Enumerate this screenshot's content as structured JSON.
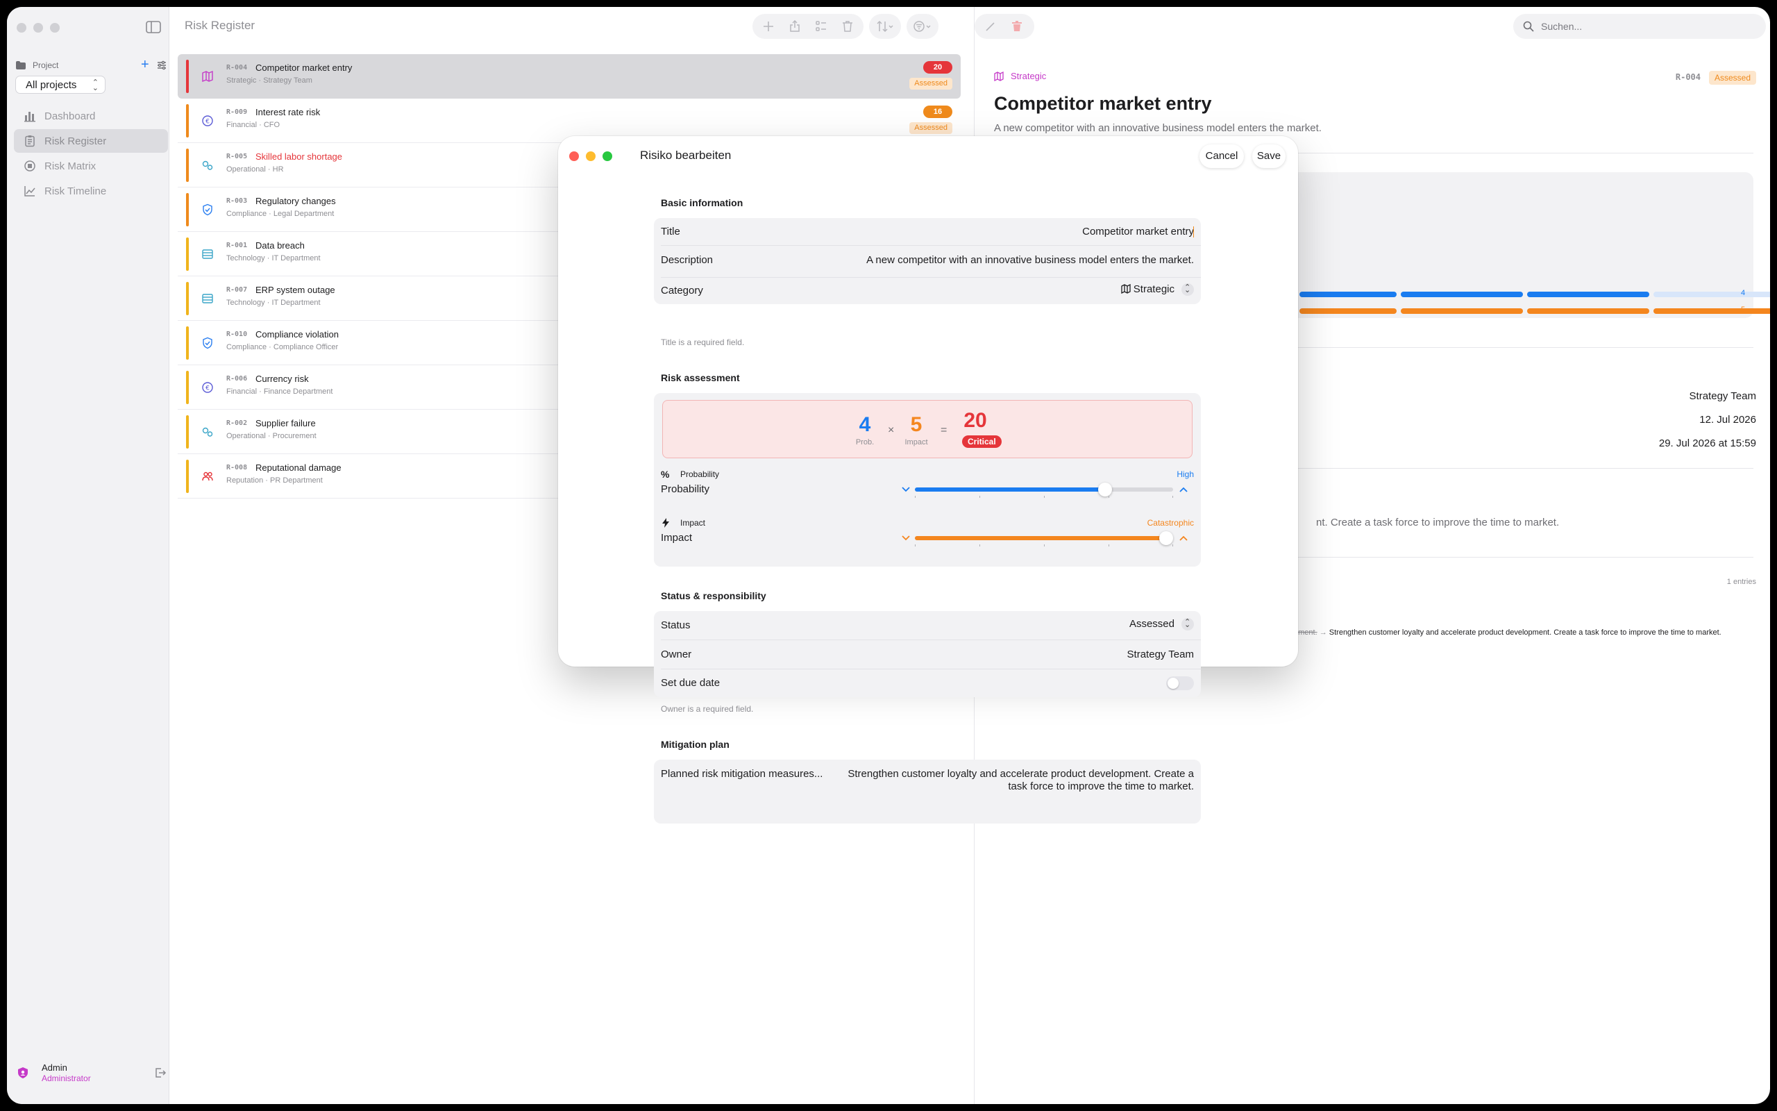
{
  "sidebar": {
    "project_label": "Project",
    "project_select": "All projects",
    "nav": [
      {
        "label": "Dashboard",
        "icon": "chart-bar-icon"
      },
      {
        "label": "Risk Register",
        "icon": "clipboard-icon"
      },
      {
        "label": "Risk Matrix",
        "icon": "grid-circle-icon"
      },
      {
        "label": "Risk Timeline",
        "icon": "line-chart-icon"
      }
    ],
    "user_name": "Admin",
    "user_role": "Administrator"
  },
  "list": {
    "title": "Risk Register",
    "items": [
      {
        "id": "R-004",
        "title": "Competitor market entry",
        "category": "Strategic",
        "owner": "Strategy Team",
        "score": "20",
        "status": "Assessed",
        "bar_color": "#e5353a",
        "score_color": "#e5353a",
        "icon": "map-icon",
        "icon_color": "#c53ac8",
        "title_color": "#1d1d1f"
      },
      {
        "id": "R-009",
        "title": "Interest rate risk",
        "category": "Financial",
        "owner": "CFO",
        "score": "16",
        "status": "Assessed",
        "bar_color": "#ef8a1c",
        "score_color": "#ef8a1c",
        "icon": "coin-icon",
        "icon_color": "#5b5bd6",
        "title_color": "#1d1d1f"
      },
      {
        "id": "R-005",
        "title": "Skilled labor shortage",
        "category": "Operational",
        "owner": "HR",
        "score": "",
        "status": "",
        "bar_color": "#ef8a1c",
        "score_color": "",
        "icon": "gears-icon",
        "icon_color": "#3aa5c8",
        "title_color": "#e5353a"
      },
      {
        "id": "R-003",
        "title": "Regulatory changes",
        "category": "Compliance",
        "owner": "Legal Department",
        "score": "",
        "status": "",
        "bar_color": "#ef8a1c",
        "score_color": "",
        "icon": "shield-check-icon",
        "icon_color": "#2a7ef0",
        "title_color": "#1d1d1f"
      },
      {
        "id": "R-001",
        "title": "Data breach",
        "category": "Technology",
        "owner": "IT Department",
        "score": "",
        "status": "",
        "bar_color": "#f0b41c",
        "score_color": "",
        "icon": "server-icon",
        "icon_color": "#3aa5c8",
        "title_color": "#1d1d1f"
      },
      {
        "id": "R-007",
        "title": "ERP system outage",
        "category": "Technology",
        "owner": "IT Department",
        "score": "",
        "status": "",
        "bar_color": "#f0b41c",
        "score_color": "",
        "icon": "server-icon",
        "icon_color": "#3aa5c8",
        "title_color": "#1d1d1f"
      },
      {
        "id": "R-010",
        "title": "Compliance violation",
        "category": "Compliance",
        "owner": "Compliance Officer",
        "score": "",
        "status": "",
        "bar_color": "#f0b41c",
        "score_color": "",
        "icon": "shield-check-icon",
        "icon_color": "#2a7ef0",
        "title_color": "#1d1d1f"
      },
      {
        "id": "R-006",
        "title": "Currency risk",
        "category": "Financial",
        "owner": "Finance Department",
        "score": "",
        "status": "",
        "bar_color": "#f0b41c",
        "score_color": "",
        "icon": "coin-icon",
        "icon_color": "#5b5bd6",
        "title_color": "#1d1d1f"
      },
      {
        "id": "R-002",
        "title": "Supplier failure",
        "category": "Operational",
        "owner": "Procurement",
        "score": "",
        "status": "",
        "bar_color": "#f0b41c",
        "score_color": "",
        "icon": "gears-icon",
        "icon_color": "#3aa5c8",
        "title_color": "#1d1d1f"
      },
      {
        "id": "R-008",
        "title": "Reputational damage",
        "category": "Reputation",
        "owner": "PR Department",
        "score": "",
        "status": "",
        "bar_color": "#f0b41c",
        "score_color": "",
        "icon": "people-icon",
        "icon_color": "#e5353a",
        "title_color": "#1d1d1f"
      }
    ]
  },
  "detail": {
    "category": "Strategic",
    "id": "R-004",
    "status": "Assessed",
    "title": "Competitor market entry",
    "description": "A new competitor with an innovative business model enters the market.",
    "prob_value": "4",
    "impact_value": "5",
    "owner": "Strategy Team",
    "due": "12. Jul 2026",
    "updated": "29. Jul 2026 at 15:59",
    "mitigation_tail": "nt. Create a task force to improve the time to market.",
    "entries": "1 entries",
    "history_old": "pment.",
    "history_arrow": "→",
    "history_new": "Strengthen customer loyalty and accelerate product development. Create a task force to improve the time to market.",
    "search_placeholder": "Suchen..."
  },
  "modal": {
    "title": "Risiko bearbeiten",
    "cancel": "Cancel",
    "save": "Save",
    "basic": {
      "heading": "Basic information",
      "title_label": "Title",
      "title_value": "Competitor market entry",
      "desc_label": "Description",
      "desc_value": "A new competitor with an innovative business model enters the market.",
      "cat_label": "Category",
      "cat_value": "Strategic",
      "hint": "Title is a required field."
    },
    "assessment": {
      "heading": "Risk assessment",
      "prob": 4,
      "prob_cap": "Prob.",
      "impact": 5,
      "impact_cap": "Impact",
      "times": "×",
      "equals": "=",
      "score": 20,
      "level": "Critical",
      "prob_small": "Probability",
      "prob_level": "High",
      "prob_label": "Probability",
      "impact_small": "Impact",
      "impact_level": "Catastrophic",
      "impact_label": "Impact",
      "scale_max": 5
    },
    "status": {
      "heading": "Status & responsibility",
      "status_label": "Status",
      "status_value": "Assessed",
      "owner_label": "Owner",
      "owner_value": "Strategy Team",
      "due_label": "Set due date",
      "due_enabled": false,
      "hint": "Owner is a required field."
    },
    "mitigation": {
      "heading": "Mitigation plan",
      "label": "Planned risk mitigation measures...",
      "value": "Strengthen customer loyalty and accelerate product development. Create a task force to improve the time to market."
    }
  },
  "colors": {
    "blue": "#1a7cf0",
    "orange": "#f4861e",
    "red": "#e5353a",
    "magenta": "#c53ac8"
  }
}
